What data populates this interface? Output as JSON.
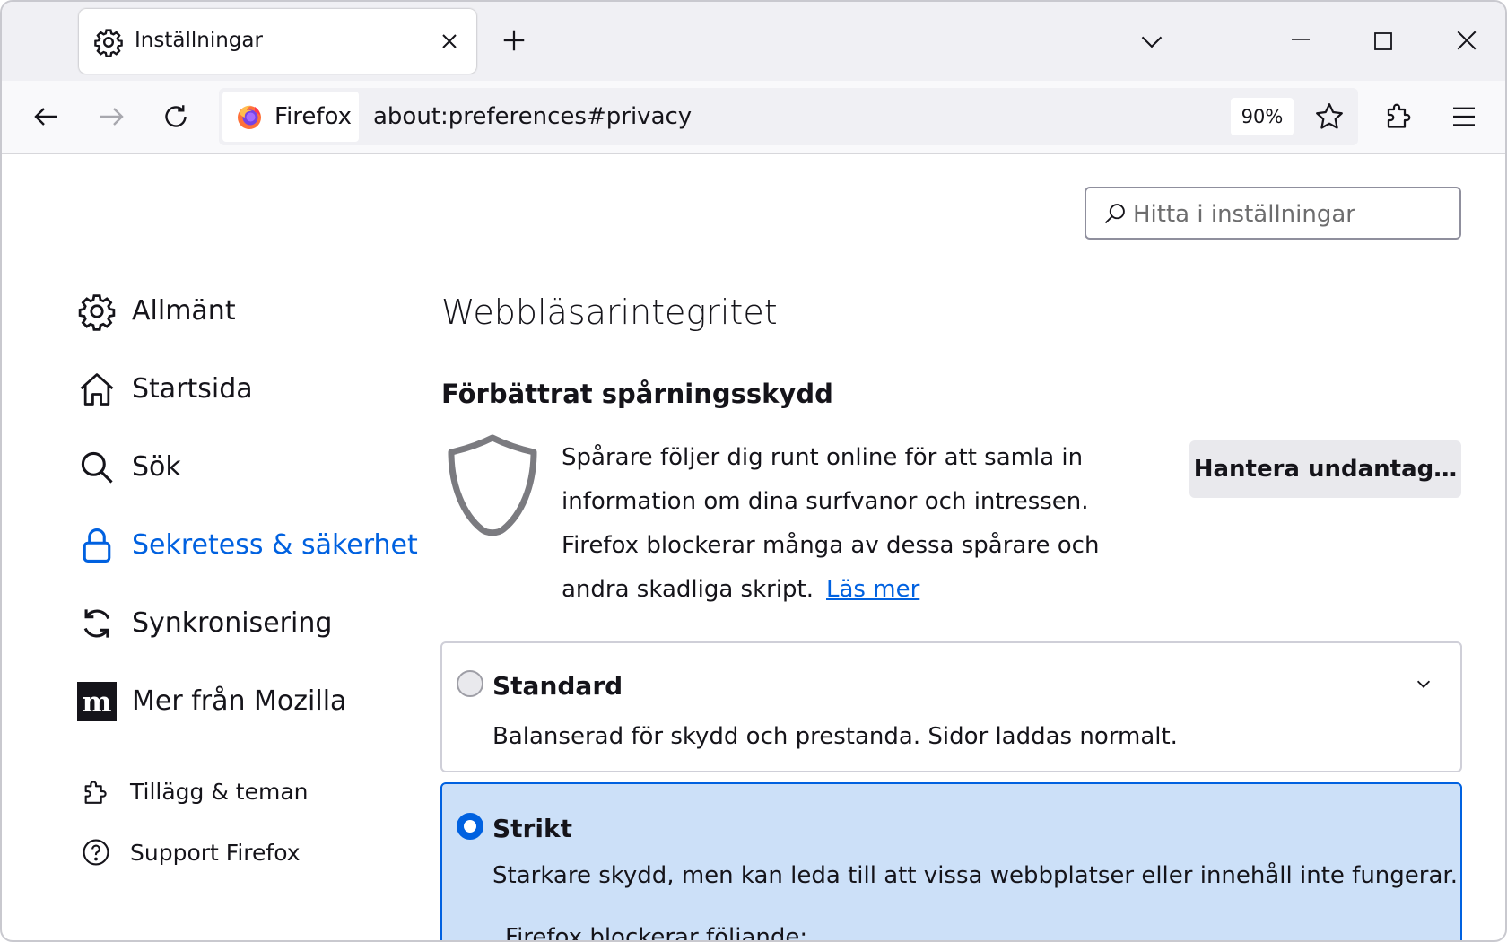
{
  "tab": {
    "title": "Inställningar",
    "icon": "gear-icon"
  },
  "navbar": {
    "identity_label": "Firefox",
    "url": "about:preferences#privacy",
    "zoom": "90%"
  },
  "search": {
    "placeholder": "Hitta i inställningar"
  },
  "sidebar": {
    "items": [
      {
        "label": "Allmänt",
        "icon": "gear-icon"
      },
      {
        "label": "Startsida",
        "icon": "home-icon"
      },
      {
        "label": "Sök",
        "icon": "search-icon"
      },
      {
        "label": "Sekretess & säkerhet",
        "icon": "lock-icon",
        "selected": true
      },
      {
        "label": "Synkronisering",
        "icon": "sync-icon"
      },
      {
        "label": "Mer från Mozilla",
        "icon": "mozilla-icon"
      }
    ],
    "footer": [
      {
        "label": "Tillägg & teman",
        "icon": "puzzle-icon"
      },
      {
        "label": "Support Firefox",
        "icon": "help-icon"
      }
    ]
  },
  "main": {
    "title": "Webbläsarintegritet",
    "etp": {
      "heading": "Förbättrat spårningsskydd",
      "description": "Spårare följer dig runt online för att samla in information om dina surfvanor och intressen. Firefox blockerar många av dessa spårare och andra skadliga skript.",
      "learn_more": "Läs mer",
      "manage_button": "Hantera undantag…"
    },
    "options": [
      {
        "title": "Standard",
        "description": "Balanserad för skydd och prestanda. Sidor laddas normalt.",
        "selected": false
      },
      {
        "title": "Strikt",
        "description": "Starkare skydd, men kan leda till att vissa webbplatser eller innehåll inte fungerar.",
        "subheading": "Firefox blockerar följande:",
        "selected": true
      }
    ]
  },
  "colors": {
    "accent": "#0061e0",
    "selected_bg": "#cce0f8"
  }
}
